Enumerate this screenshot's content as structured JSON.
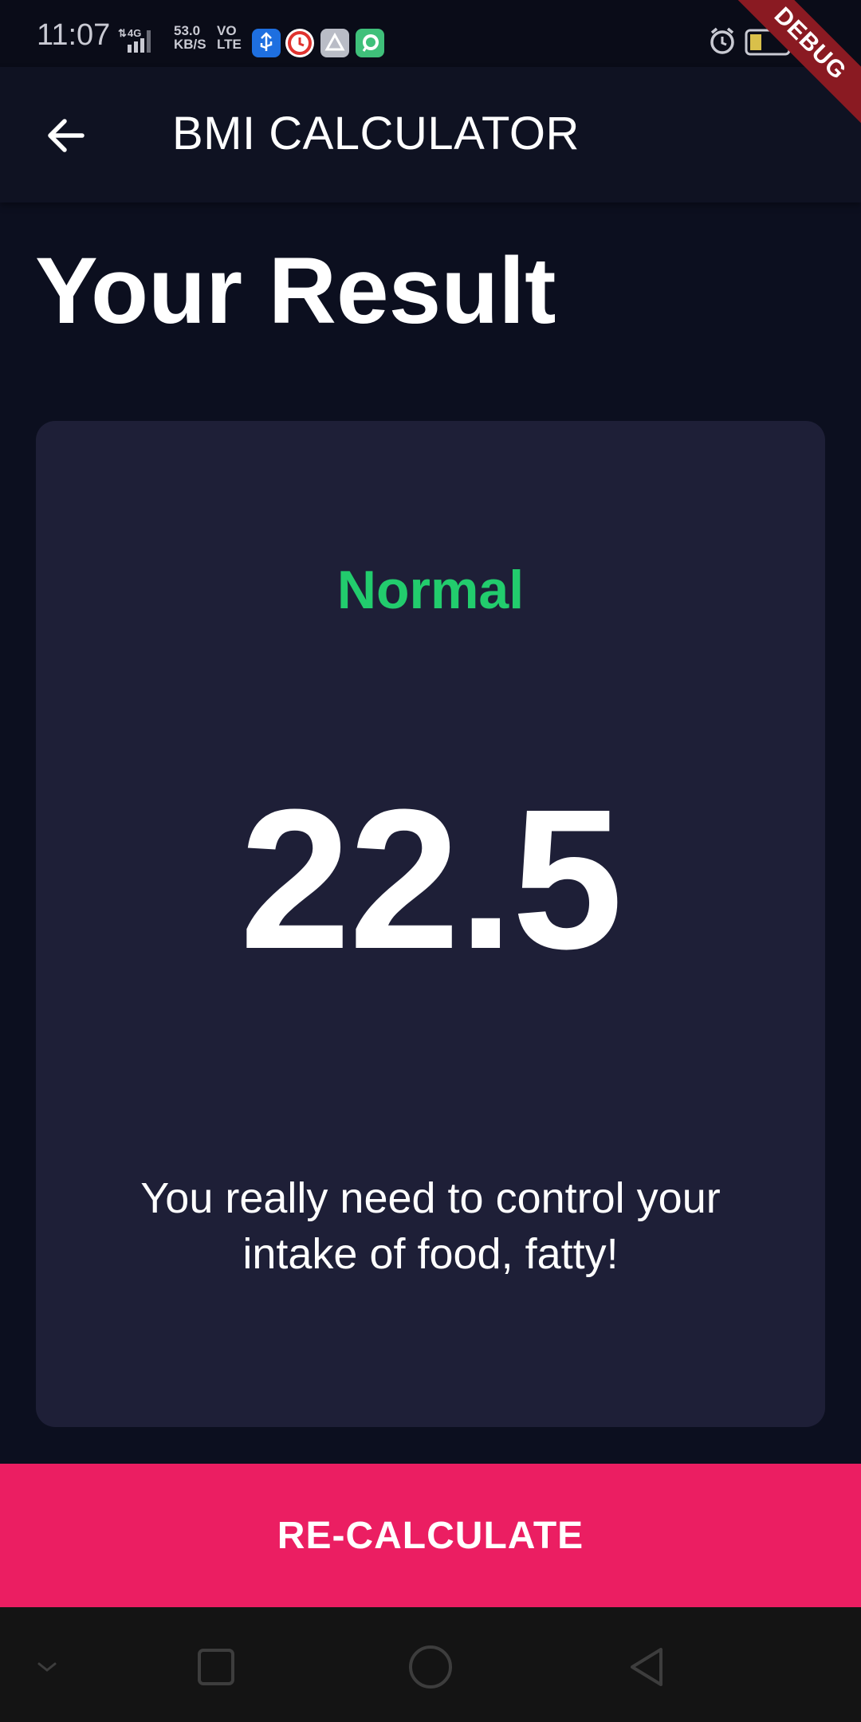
{
  "status_bar": {
    "time": "11:07",
    "network_type": "4G",
    "speed_value": "53.0",
    "speed_unit": "KB/S",
    "volte_top": "VO",
    "volte_bottom": "LTE",
    "battery": "30",
    "icons": [
      "usb-icon",
      "clock-app-icon",
      "drive-icon",
      "chat-app-icon",
      "alarm-icon",
      "battery-icon",
      "charging-icon"
    ]
  },
  "debug_banner": "DEBUG",
  "app_bar": {
    "title": "BMI CALCULATOR",
    "back_icon": "arrow-back-icon"
  },
  "page_title": "Your Result",
  "result": {
    "category": "Normal",
    "bmi_value": "22.5",
    "message": "You really need to control your intake of food, fatty!"
  },
  "recalculate_button": {
    "label": "RE-CALCULATE"
  },
  "nav_bar": {
    "buttons": [
      "hide-nav-icon",
      "recents-icon",
      "home-icon",
      "back-nav-icon"
    ]
  },
  "colors": {
    "background": "#0c0f1f",
    "app_bar": "#0f1222",
    "card": "#1e1f37",
    "category_green": "#22cc6d",
    "accent_pink": "#eb1e62",
    "text_white": "#ffffff"
  }
}
